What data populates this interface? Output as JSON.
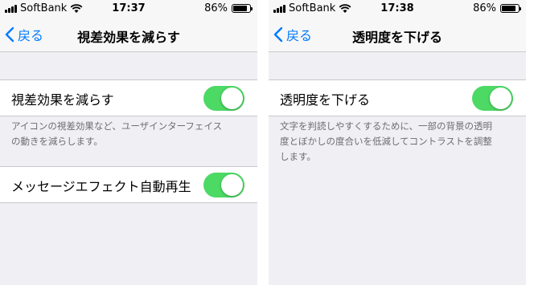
{
  "left": {
    "status": {
      "carrier": "SoftBank",
      "time": "17:37",
      "battery": "86%",
      "battery_level": 0.86
    },
    "nav": {
      "back_label": "戻る",
      "title": "視差効果を減らす"
    },
    "rows": [
      {
        "label": "視差効果を減らす",
        "toggle_on": true
      },
      {
        "label": "メッセージエフェクト自動再生",
        "toggle_on": true
      }
    ],
    "footnote_lines": [
      "アイコンの視差効果など、ユーザインターフェイス",
      "の動きを減らします。"
    ]
  },
  "right": {
    "status": {
      "carrier": "SoftBank",
      "time": "17:38",
      "battery": "86%",
      "battery_level": 0.86
    },
    "nav": {
      "back_label": "戻る",
      "title": "透明度を下げる"
    },
    "rows": [
      {
        "label": "透明度を下げる",
        "toggle_on": true
      }
    ],
    "footnote_lines": [
      "文字を判読しやすくするために、一部の背景の透明",
      "度とぼかしの度合いを低減してコントラストを調整",
      "します。"
    ]
  },
  "colors": {
    "accent": "#007aff",
    "toggle_on": "#4cd964",
    "background": "#efeff4"
  }
}
